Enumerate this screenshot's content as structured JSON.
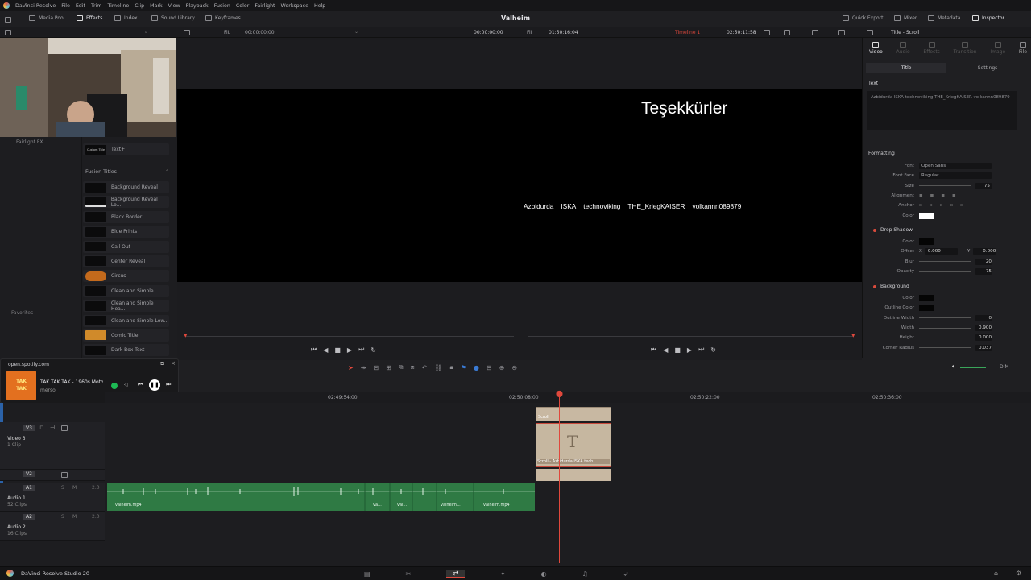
{
  "menu": {
    "app": "DaVinci Resolve",
    "items": [
      "File",
      "Edit",
      "Trim",
      "Timeline",
      "Clip",
      "Mark",
      "View",
      "Playback",
      "Fusion",
      "Color",
      "Fairlight",
      "Workspace",
      "Help"
    ]
  },
  "toolbar": {
    "media_pool": "Media Pool",
    "effects": "Effects",
    "index": "Index",
    "sound_library": "Sound Library",
    "keyframes": "Keyframes",
    "project_title": "Valheim",
    "quick_export": "Quick Export",
    "mixer": "Mixer",
    "metadata": "Metadata",
    "inspector": "Inspector"
  },
  "viewerbar": {
    "fit_left": "Fit",
    "tc_left": "00:00:00:00",
    "tc_mid": "00:00:00:00",
    "fit_mid": "Fit",
    "duration": "01:50:16:04",
    "timeline_name": "Timeline 1",
    "tc_right": "02:50:11:58",
    "inspector_title": "Title - Scroll"
  },
  "left": {
    "fairlight_fx": "Fairlight FX",
    "favorites": "Favorites",
    "custom_title": "Custom Title",
    "text_plus": "Text+",
    "fusion_titles": "Fusion Titles",
    "templates": [
      "Background Reveal",
      "Background Reveal Lo...",
      "Black Border",
      "Blue Prints",
      "Call Out",
      "Center Reveal",
      "Circus",
      "Clean and Simple",
      "Clean and Simple Hea...",
      "Clean and Simple Low...",
      "Comic Title",
      "Dark Box Text"
    ]
  },
  "viewer": {
    "title": "Teşekkürler",
    "credits": [
      "Azbidurda",
      "ISKA",
      "technoviking",
      "THE_KriegKAISER",
      "volkannn089879"
    ]
  },
  "inspector": {
    "tabs": [
      "Video",
      "Audio",
      "Effects",
      "Transition",
      "Image",
      "File"
    ],
    "sub_title": "Title",
    "sub_settings": "Settings",
    "text_section": "Text",
    "text_value": "Azbidurda   ISKA   technoviking   THE_KriegKAISER   volkannn089879",
    "formatting": "Formatting",
    "font_label": "Font",
    "font": "Open Sans",
    "face_label": "Font Face",
    "face": "Regular",
    "size_label": "Size",
    "size": "75",
    "alignment_label": "Alignment",
    "anchor_label": "Anchor",
    "color_label": "Color",
    "drop_shadow": "Drop Shadow",
    "ds_color": "Color",
    "offset_label": "Offset",
    "x_label": "X",
    "offset_x": "0.000",
    "y_label": "Y",
    "offset_y": "0.000",
    "blur_label": "Blur",
    "blur": "20",
    "opacity_label": "Opacity",
    "opacity": "75",
    "background": "Background",
    "bg_color": "Color",
    "outline_color": "Outline Color",
    "outline_width_label": "Outline Width",
    "outline_width": "0",
    "width_label": "Width",
    "width": "0.900",
    "height_label": "Height",
    "height": "0.000",
    "corner_label": "Corner Radius",
    "corner": "0.037",
    "colors": {
      "text": "#ffffff",
      "shadow": "#000000",
      "bg": "#000000"
    }
  },
  "spotify": {
    "site": "open.spotify.com",
    "track": "TAK TAK TAK - 1960s Moto",
    "artist": "merso"
  },
  "timeline": {
    "ruler": [
      "02:49:54:00",
      "02:50:08:00",
      "02:50:22:00",
      "02:50:36:00"
    ],
    "dim": "DIM",
    "v3": "V3",
    "v2": "V2",
    "a1": "A1",
    "a2": "A2",
    "video3": "Video 3",
    "video3_clips": "1 Clip",
    "audio1": "Audio 1",
    "audio1_clips": "52 Clips",
    "audio2": "Audio 2",
    "audio2_clips": "16 Clips",
    "level": "2.0",
    "scroll_label": "Scroll",
    "title_clip": "Scroll - Azbidurda   ISKA   tech...",
    "audio_clips": [
      "valheim.mp4",
      "va...",
      "val...",
      "valheim...",
      "valheim.mp4"
    ]
  },
  "bottom": {
    "product": "DaVinci Resolve Studio 20"
  }
}
